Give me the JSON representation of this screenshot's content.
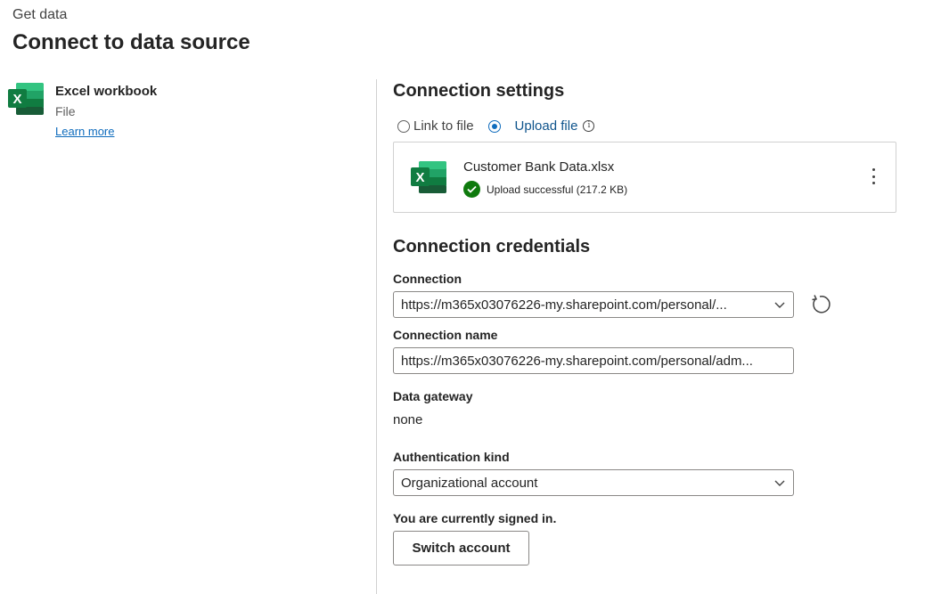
{
  "header": {
    "breadcrumb": "Get data",
    "title": "Connect to data source"
  },
  "source": {
    "icon": "excel-icon",
    "name": "Excel workbook",
    "type": "File",
    "learn_more": "Learn more"
  },
  "connection_settings": {
    "title": "Connection settings",
    "options": [
      {
        "label": "Link to file",
        "selected": false
      },
      {
        "label": "Upload file",
        "selected": true
      }
    ],
    "file": {
      "name": "Customer Bank Data.xlsx",
      "status": "Upload successful (217.2 KB)"
    }
  },
  "credentials": {
    "title": "Connection credentials",
    "connection_label": "Connection",
    "connection_value": "https://m365x03076226-my.sharepoint.com/personal/...",
    "connection_name_label": "Connection name",
    "connection_name_value": "https://m365x03076226-my.sharepoint.com/personal/adm...",
    "gateway_label": "Data gateway",
    "gateway_value": "none",
    "auth_label": "Authentication kind",
    "auth_value": "Organizational account",
    "signed_in_text": "You are currently signed in.",
    "switch_account": "Switch account"
  },
  "colors": {
    "accent": "#0f6cbd",
    "success": "#0e7a0d",
    "excel_green": "#107c41"
  }
}
